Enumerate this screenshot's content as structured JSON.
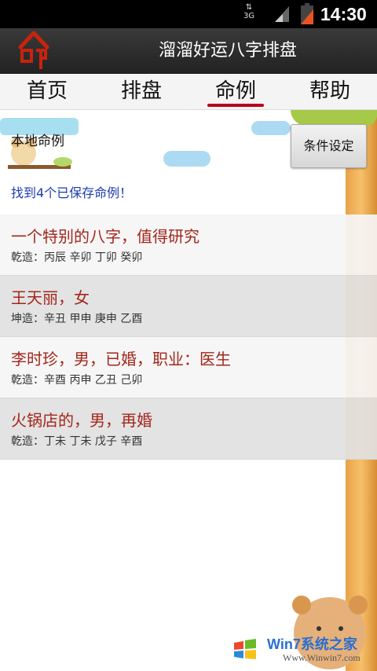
{
  "status_bar": {
    "time": "14:30",
    "network": "3G"
  },
  "header": {
    "title": "溜溜好运八字排盘"
  },
  "tabs": [
    {
      "label": "首页"
    },
    {
      "label": "排盘"
    },
    {
      "label": "命例"
    },
    {
      "label": "帮助"
    }
  ],
  "active_tab": "命例",
  "main": {
    "section_label": "本地命例",
    "filter_button": "条件设定",
    "found_text": "找到4个已保存命例！",
    "records": [
      {
        "title": "一个特别的八字，值得研究",
        "detail": "乾造：丙辰 辛卯 丁卯 癸卯"
      },
      {
        "title": "王天丽，女",
        "detail": "坤造：辛丑 甲申 庚申 乙酉"
      },
      {
        "title": "李时珍，男，已婚，职业：医生",
        "detail": "乾造：辛酉 丙申 乙丑 己卯"
      },
      {
        "title": "火锅店的，男，再婚",
        "detail": "乾造：丁未 丁未 戊子 辛酉"
      }
    ]
  },
  "watermark": {
    "brand": "Win7系统之家",
    "url": "Www.Winwin7.com"
  },
  "colors": {
    "accent": "#b8001e",
    "record_title": "#a3261b",
    "found_text": "#1c3bb0"
  }
}
